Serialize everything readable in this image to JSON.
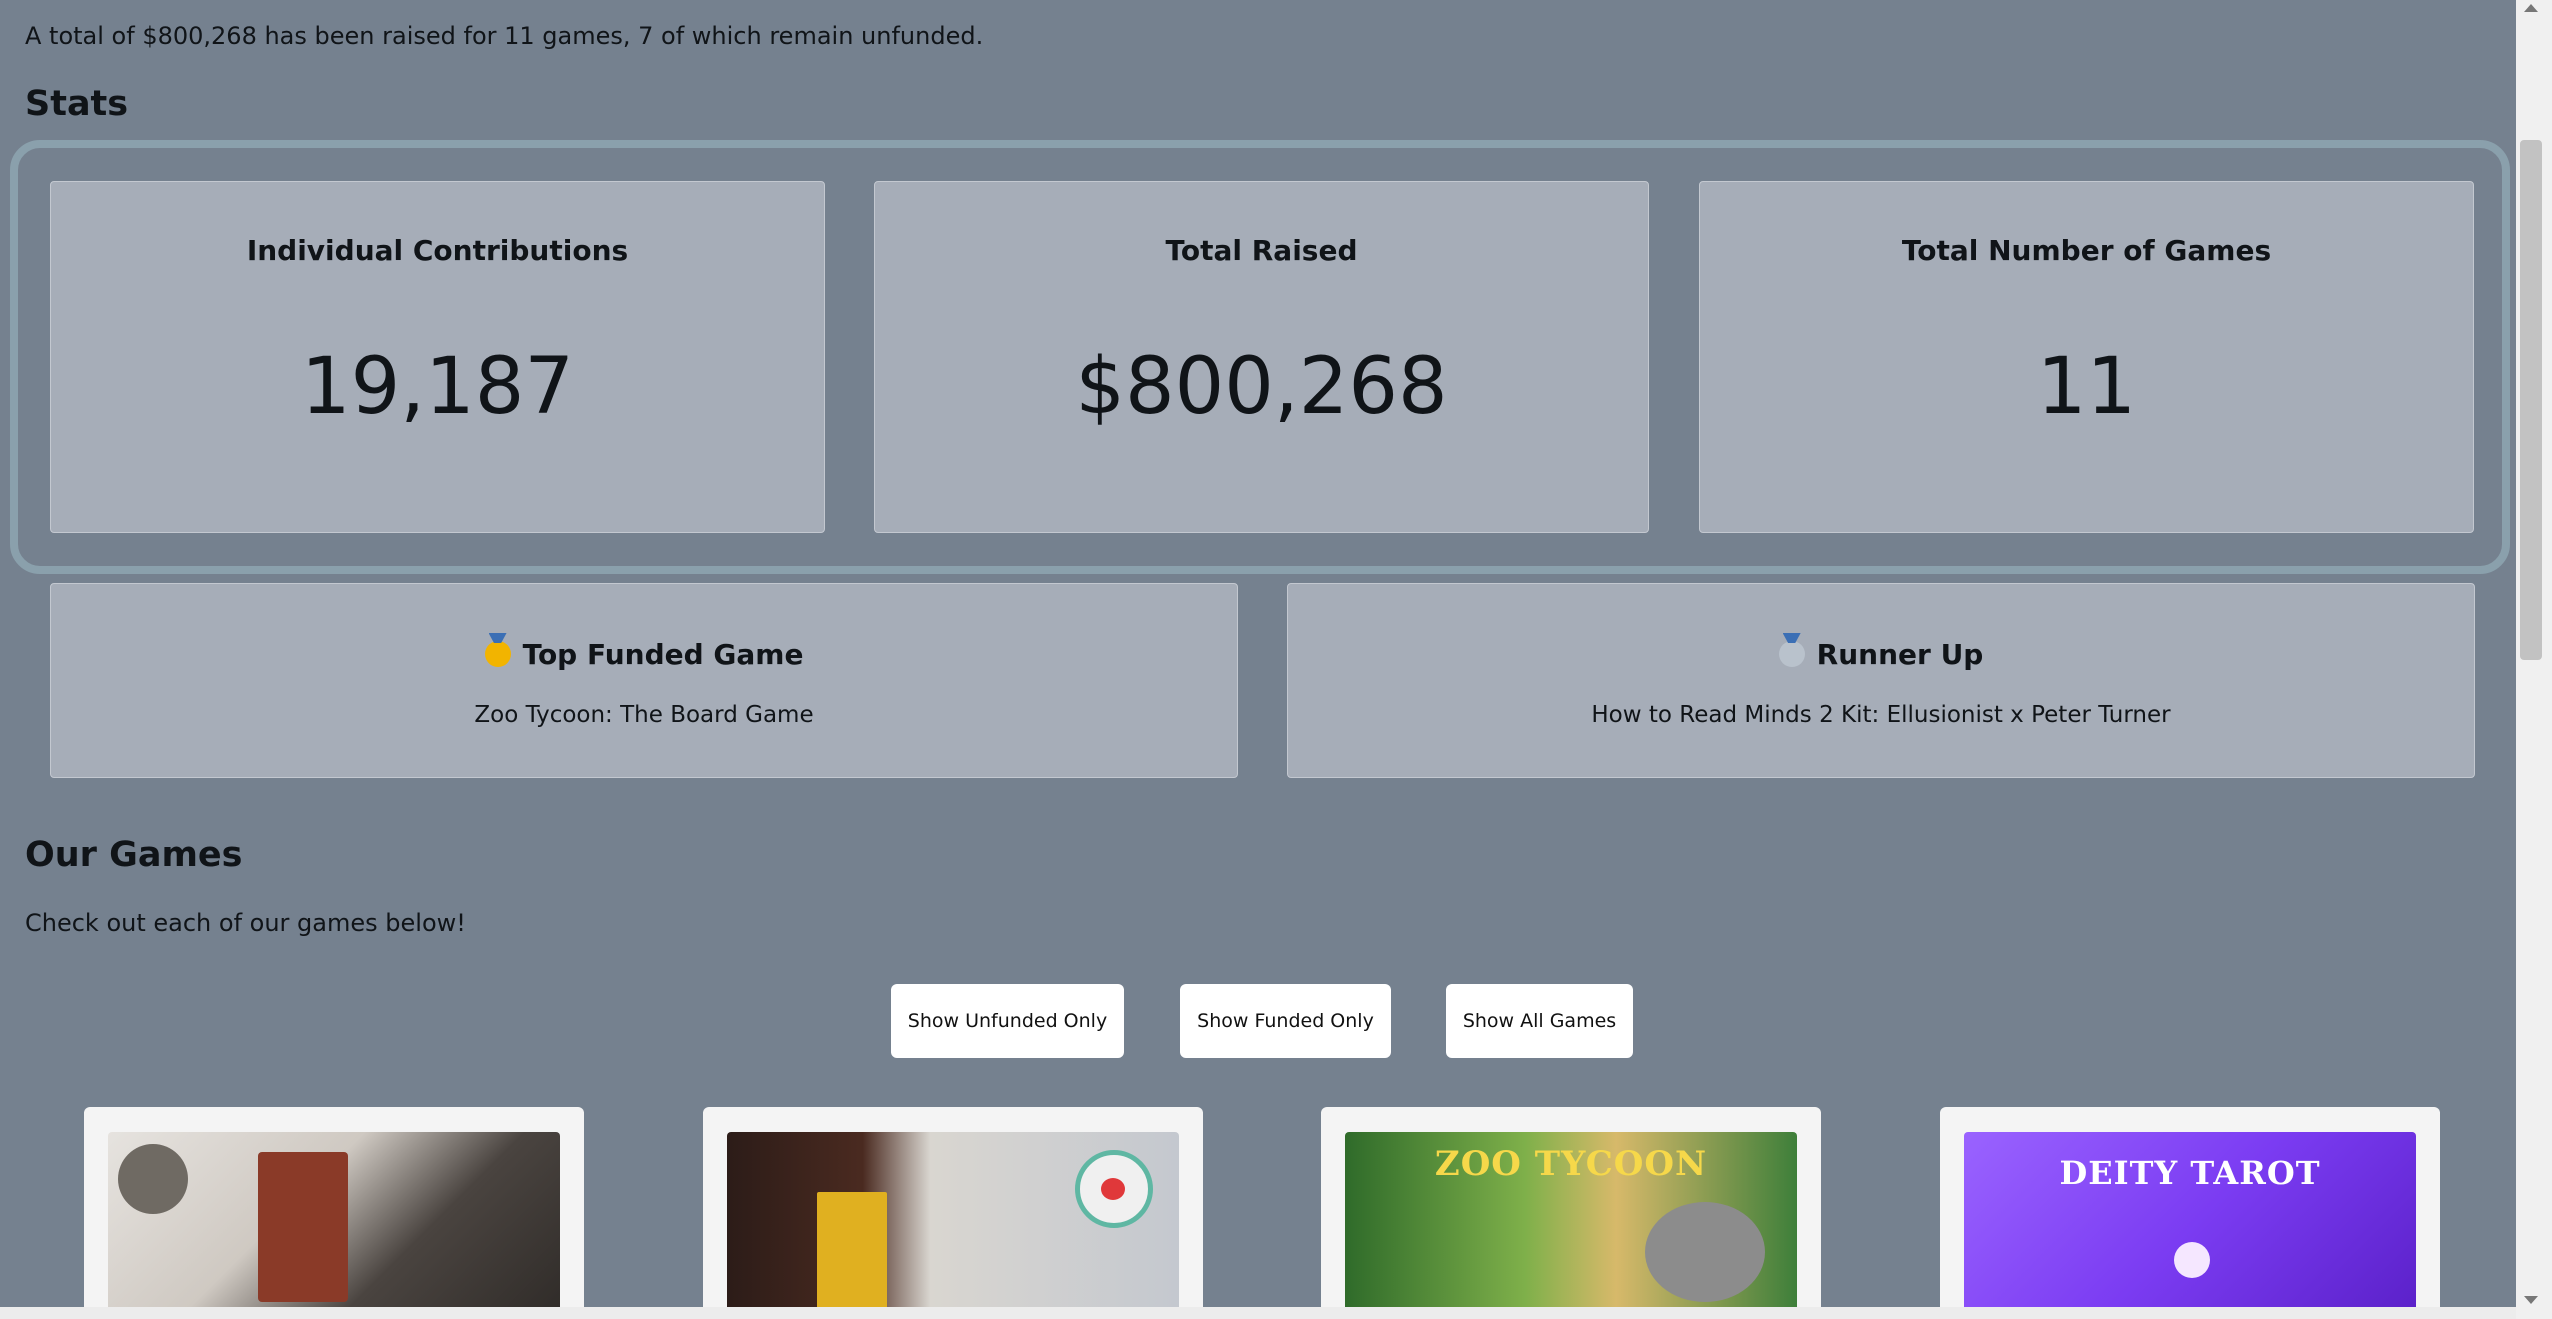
{
  "summary_text": "A total of $800,268 has been raised for 11 games, 7 of which remain unfunded.",
  "stats_heading": "Stats",
  "stats": [
    {
      "label": "Individual Contributions",
      "value": "19,187"
    },
    {
      "label": "Total Raised",
      "value": "$800,268"
    },
    {
      "label": "Total Number of Games",
      "value": "11"
    }
  ],
  "top_games": [
    {
      "icon": "gold-medal-icon",
      "heading": "Top Funded Game",
      "name": "Zoo Tycoon: The Board Game"
    },
    {
      "icon": "silver-medal-icon",
      "heading": "Runner Up",
      "name": "How to Read Minds 2 Kit: Ellusionist x Peter Turner"
    }
  ],
  "games_heading": "Our Games",
  "games_subtitle": "Check out each of our games below!",
  "buttons": {
    "unfunded": "Show Unfunded Only",
    "funded": "Show Funded Only",
    "all": "Show All Games"
  },
  "game_cards": [
    {
      "image_text": ""
    },
    {
      "image_text": ""
    },
    {
      "image_text": "ZOO TYCOON"
    },
    {
      "image_text": "DEITY TAROT"
    }
  ],
  "colors": {
    "background": "#75818f",
    "card": "#a6adb8",
    "band_border": "#8aa0ac",
    "button": "#ffffff"
  }
}
